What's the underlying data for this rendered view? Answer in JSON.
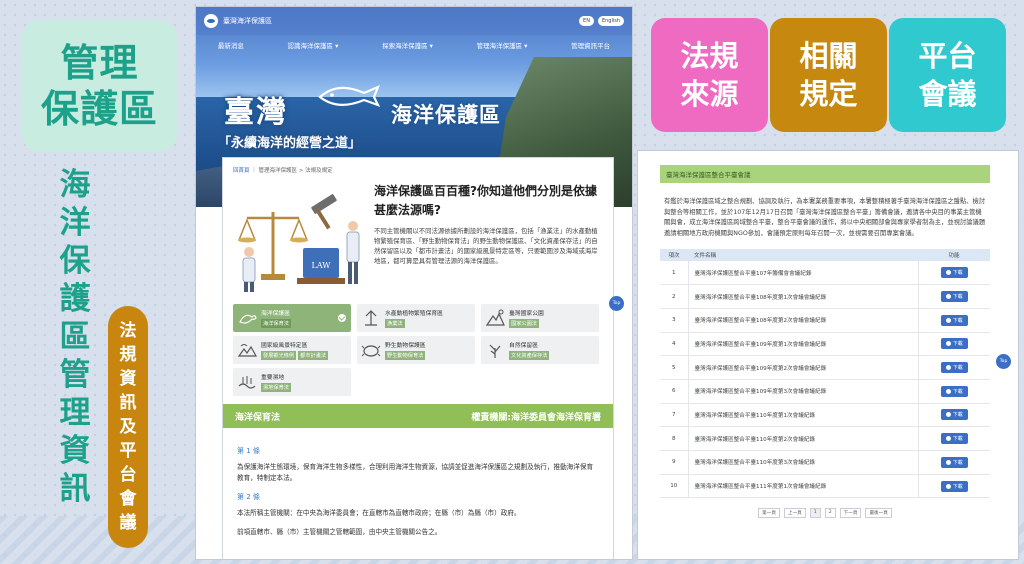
{
  "left": {
    "title_chars": [
      "管理",
      "保護區"
    ],
    "vertical_title": [
      "海",
      "洋",
      "保",
      "護",
      "區",
      "管",
      "理",
      "資",
      "訊"
    ],
    "pill_chars": [
      "法",
      "規",
      "資",
      "訊",
      "及",
      "平",
      "台",
      "會",
      "議"
    ]
  },
  "site1": {
    "site_name": "臺灣海洋保護區",
    "lang": [
      "EN",
      "English"
    ],
    "nav": [
      "最新消息",
      "認識海洋保護區 ▾",
      "探索海洋保護區 ▾",
      "管理海洋保護區 ▾",
      "管理資訊平台"
    ],
    "hero_title": "臺灣",
    "hero_title_2": "海洋保護區",
    "slogan": "「永續海洋的經營之道」",
    "breadcrumb_home": "回首頁",
    "breadcrumb_rest": " ｜ 管理海洋保護區 > 法規及規定",
    "intro_head": "海洋保護區百百種?你知道他們分別是依據甚麼法源嗎?",
    "intro_body": "不同主管機關以不同法源依據所劃設的海洋保護區，包括「漁業法」的水產動植物繁殖保育區、「野生動物保育法」的野生動物保護區、「文化資產保存法」的自然保留區以及「都市計畫法」的國家級風景特定區等，只要範圍涉及海域或海岸地區，都可算是具有管理法源的海洋保護區。",
    "law_badge": "LAW",
    "categories": [
      {
        "name": "海洋保護區",
        "tags": [
          "海洋保育法"
        ],
        "active": true
      },
      {
        "name": "水產動植物繁殖保育區",
        "tags": [
          "漁業法"
        ],
        "active": false
      },
      {
        "name": "臺灣國家公園",
        "tags": [
          "國家公園法"
        ],
        "active": false
      },
      {
        "name": "國家級風景特定區",
        "tags": [
          "發展觀光條例",
          "都市計畫法"
        ],
        "active": false
      },
      {
        "name": "野生動物保護區",
        "tags": [
          "野生動物保育法"
        ],
        "active": false
      },
      {
        "name": "自然保留區",
        "tags": [
          "文化資產保存法"
        ],
        "active": false
      },
      {
        "name": "重要濕地",
        "tags": [
          "濕地保育法"
        ],
        "active": false
      }
    ],
    "law_name": "海洋保育法",
    "law_authority": "權責機關:海洋委員會海洋保育署",
    "articles": [
      {
        "no": "第 1 條",
        "text": "為保護海洋生態環境，保育海洋生物多樣性，合理利用海洋生物資源，協調並促進海洋保護區之規劃及執行，推動海洋保育教育，特制定本法。"
      },
      {
        "no": "第 2 條",
        "text": "本法所稱主管機關：在中央為海洋委員會；在直轄市為直轄市政府；在縣（市）為縣（市）政府。"
      },
      {
        "no": "",
        "text": "前項直轄市、縣（市）主管機關之管轄範圍，由中央主管機關公告之。"
      }
    ],
    "top_label": "Top"
  },
  "tiles": [
    {
      "lines": [
        "法規",
        "來源"
      ],
      "color": "#ee6bc1"
    },
    {
      "lines": [
        "相關",
        "規定"
      ],
      "color": "#c6880e"
    },
    {
      "lines": [
        "平台",
        "會議"
      ],
      "color": "#2fc9cf"
    }
  ],
  "site2": {
    "header": "臺灣海洋保護區整合平臺會議",
    "desc": "有鑑於海洋保護區域之整合規劃、協調及執行，為本署業務重要事項，本署整積極著手臺灣海洋保護區之盤點、檢討與整合等相關工作，並於107年12月17日召開「臺灣海洋保護區整合平臺」籌備會議，邀請各中央目的事業主管機關與會，成立海洋保護區跨域整合平臺，整合平臺會議的運作，將以中央相關部會與專家學者制為主，並視討論議題邀請相關地方政府機關與NGO參加，會議預定原則每年召開一次，並視需要召開專案會議。",
    "columns": [
      "項次",
      "文件名稱",
      "功能"
    ],
    "rows": [
      {
        "no": "1",
        "name": "臺灣海洋保護區整合平臺107年籌備會會議紀錄"
      },
      {
        "no": "2",
        "name": "臺灣海洋保護區整合平臺108年度第1次會議會議紀錄"
      },
      {
        "no": "3",
        "name": "臺灣海洋保護區整合平臺108年度第2次會議會議紀錄"
      },
      {
        "no": "4",
        "name": "臺灣海洋保護區整合平臺109年度第1次會議會議紀錄"
      },
      {
        "no": "5",
        "name": "臺灣海洋保護區整合平臺109年度第2次會議會議紀錄"
      },
      {
        "no": "6",
        "name": "臺灣海洋保護區整合平臺109年度第3次會議會議紀錄"
      },
      {
        "no": "7",
        "name": "臺灣海洋保護區整合平臺110年度第1次會議紀錄"
      },
      {
        "no": "8",
        "name": "臺灣海洋保護區整合平臺110年度第2次會議紀錄"
      },
      {
        "no": "9",
        "name": "臺灣海洋保護區整合平臺110年度第3次會議紀錄"
      },
      {
        "no": "10",
        "name": "臺灣海洋保護區整合平臺111年度第1次會議會議紀錄"
      }
    ],
    "download_label": "下載",
    "pager": [
      "第一頁",
      "上一頁",
      "1",
      "2",
      "下一頁",
      "最後一頁"
    ],
    "top_label": "Top"
  }
}
